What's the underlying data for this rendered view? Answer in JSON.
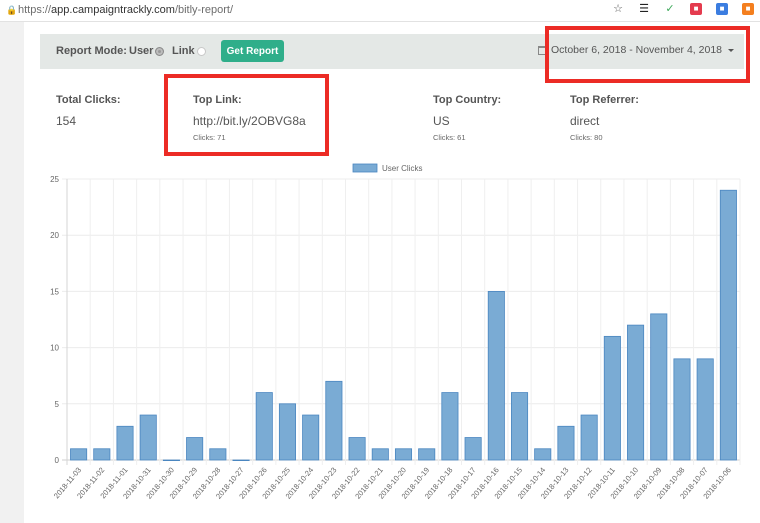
{
  "browser": {
    "url_scheme": "https://",
    "url_host": "app.campaigntrackly.com",
    "url_path": "/bitly-report/",
    "icons": [
      "star-icon",
      "layers-extension-icon",
      "leaf-extension-icon",
      "red-extension-icon",
      "blue-extension-icon",
      "orange-extension-icon"
    ]
  },
  "toolbar": {
    "report_mode_label": "Report Mode:",
    "options": [
      {
        "label": "User",
        "checked": true
      },
      {
        "label": "Link",
        "checked": false
      }
    ],
    "get_report_label": "Get Report",
    "date_range": "October 6, 2018 - November 4, 2018"
  },
  "stats": {
    "total_clicks": {
      "title": "Total Clicks:",
      "value": "154"
    },
    "top_link": {
      "title": "Top Link:",
      "value": "http://bit.ly/2OBVG8a",
      "sub": "Clicks: 71"
    },
    "top_country": {
      "title": "Top Country:",
      "value": "US",
      "sub": "Clicks: 61"
    },
    "top_referrer": {
      "title": "Top Referrer:",
      "value": "direct",
      "sub": "Clicks: 80"
    }
  },
  "colors": {
    "bar_fill": "#7aabd4",
    "bar_stroke": "#4a86c0",
    "highlight": "#ec2b25",
    "button": "#2fae8a"
  },
  "chart_data": {
    "type": "bar",
    "title": "",
    "legend": [
      "User Clicks"
    ],
    "legend_position": "top",
    "xlabel": "",
    "ylabel": "",
    "ylim": [
      0,
      25
    ],
    "yticks": [
      0,
      5,
      10,
      15,
      20,
      25
    ],
    "grid": true,
    "categories": [
      "2018-11-03",
      "2018-11-02",
      "2018-11-01",
      "2018-10-31",
      "2018-10-30",
      "2018-10-29",
      "2018-10-28",
      "2018-10-27",
      "2018-10-26",
      "2018-10-25",
      "2018-10-24",
      "2018-10-23",
      "2018-10-22",
      "2018-10-21",
      "2018-10-20",
      "2018-10-19",
      "2018-10-18",
      "2018-10-17",
      "2018-10-16",
      "2018-10-15",
      "2018-10-14",
      "2018-10-13",
      "2018-10-12",
      "2018-10-11",
      "2018-10-10",
      "2018-10-09",
      "2018-10-08",
      "2018-10-07",
      "2018-10-06"
    ],
    "series": [
      {
        "name": "User Clicks",
        "values": [
          1,
          1,
          3,
          4,
          0,
          2,
          1,
          0,
          6,
          5,
          4,
          7,
          2,
          1,
          1,
          1,
          6,
          2,
          15,
          6,
          1,
          3,
          4,
          11,
          12,
          13,
          9,
          9,
          24
        ]
      }
    ]
  }
}
